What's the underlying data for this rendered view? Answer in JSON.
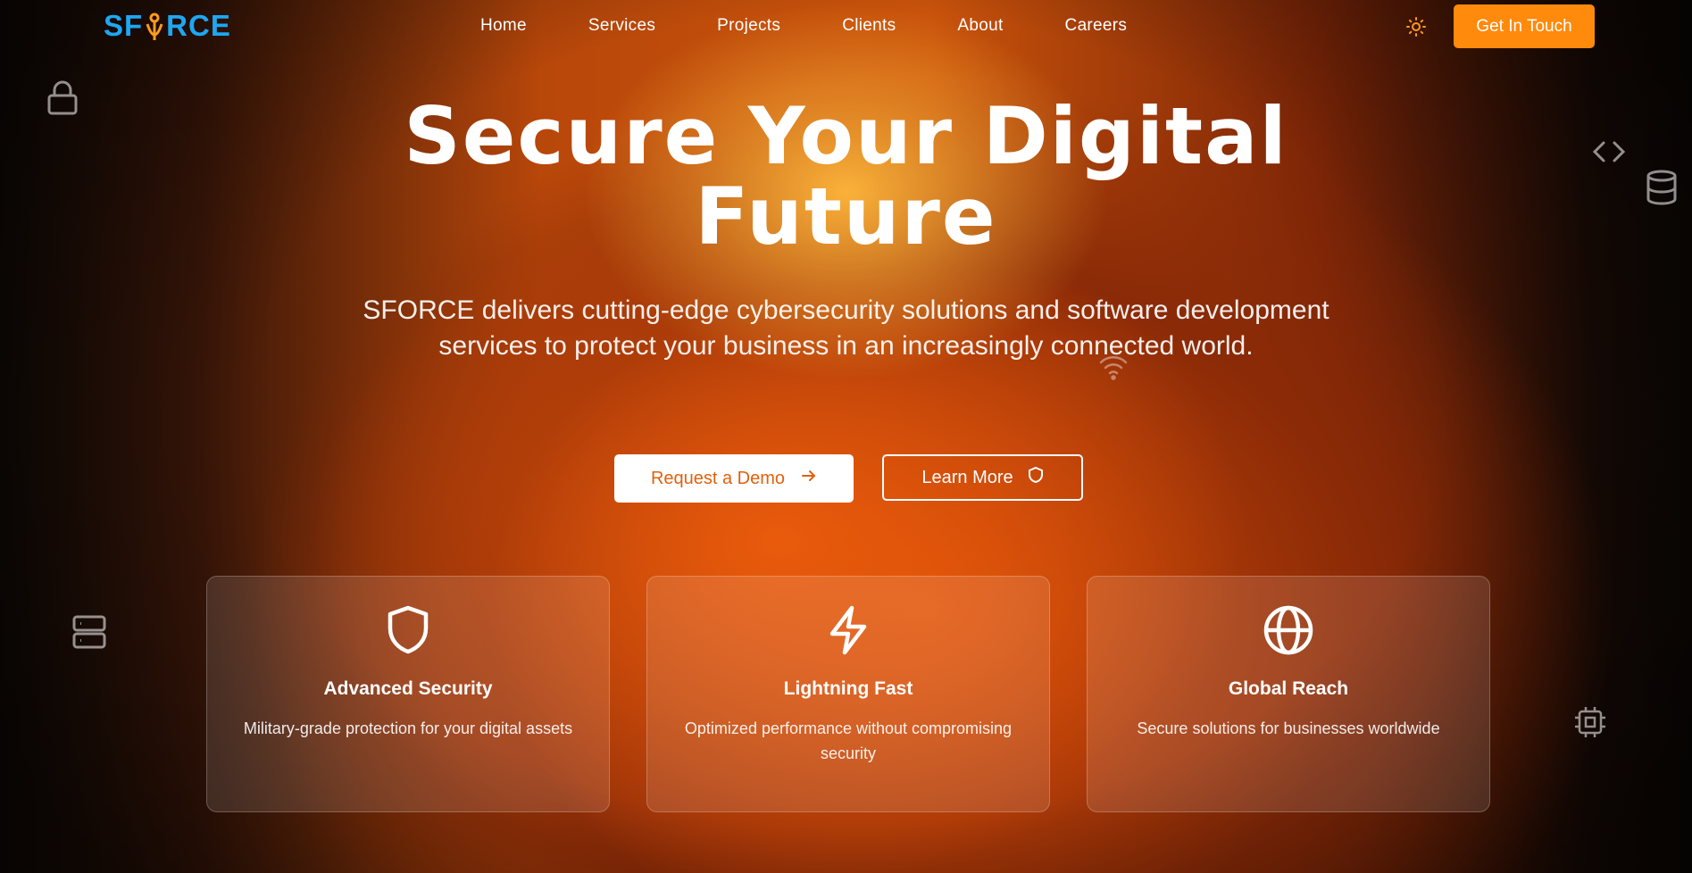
{
  "nav": {
    "logo_prefix": "SF",
    "logo_suffix": "RCE",
    "links": [
      "Home",
      "Services",
      "Projects",
      "Clients",
      "About",
      "Careers"
    ],
    "cta": "Get In Touch",
    "theme_icon": "sun-icon"
  },
  "hero": {
    "title_line1": "Secure Your Digital",
    "title_line2": "Future",
    "subtitle": "SFORCE delivers cutting-edge cybersecurity solutions and software development services to protect your business in an increasingly connected world.",
    "primary_button": "Request a Demo",
    "secondary_button": "Learn More"
  },
  "features": [
    {
      "icon": "shield-icon",
      "title": "Advanced Security",
      "description": "Military-grade protection for your digital assets"
    },
    {
      "icon": "lightning-icon",
      "title": "Lightning Fast",
      "description": "Optimized performance without compromising security"
    },
    {
      "icon": "globe-icon",
      "title": "Global Reach",
      "description": "Secure solutions for businesses worldwide"
    }
  ],
  "colors": {
    "brand_blue": "#1ea7f2",
    "accent_orange": "#ff8a0c"
  }
}
